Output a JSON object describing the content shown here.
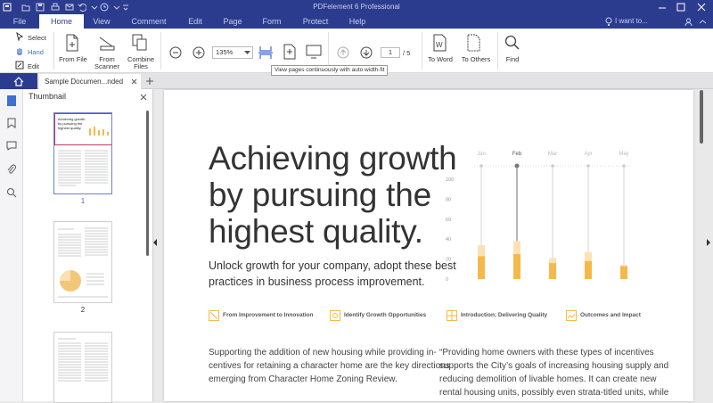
{
  "window": {
    "title": "PDFelement 6 Professional"
  },
  "menu": {
    "items": [
      "File",
      "Home",
      "View",
      "Comment",
      "Edit",
      "Page",
      "Form",
      "Protect",
      "Help"
    ],
    "search_placeholder": "I want to..."
  },
  "ribbon": {
    "select": "Select",
    "hand": "Hand",
    "edit": "Edit",
    "from_file": "From File",
    "from_scanner_1": "From",
    "from_scanner_2": "Scanner",
    "combine_1": "Combine",
    "combine_2": "Files",
    "zoom": "135%",
    "page_current": "1",
    "page_total": "/ 5",
    "to_word": "To Word",
    "to_others": "To Others",
    "find": "Find",
    "tooltip": "View pages continuously with auto width-fit"
  },
  "tabs": {
    "doc": "Sample Documen...nded"
  },
  "thumbnail": {
    "title": "Thumbnail",
    "pages": [
      "1",
      "2"
    ],
    "snippet": [
      "Achieving growth",
      "by pursuing the",
      "highest quality."
    ]
  },
  "document": {
    "title": [
      "Achieving growth",
      "by pursuing the",
      "highest quality."
    ],
    "subtitle": [
      "Unlock growth for your company, adopt these best",
      "practices in business process improvement."
    ],
    "features": [
      "From Improvement to Innovation",
      "Identify Growth Opportunities",
      "Introduction; Delivering Quality",
      "Outcomes and Impact"
    ],
    "col1": [
      "Supporting the addition of new housing while providing in-",
      "centives for retaining a character home are the key directions",
      "emerging from Character Home Zoning Review."
    ],
    "col2": [
      "“Providing home owners with these types of incentives",
      "supports the City’s goals of increasing housing supply and",
      "reducing demolition of livable homes.  It can create new",
      "rental housing units, possibly even strata-titled units, while"
    ]
  },
  "chart_data": {
    "type": "bar",
    "categories": [
      "Jan",
      "Feb",
      "Mar",
      "Apr",
      "May"
    ],
    "highlighted_category": "Feb",
    "ylim": [
      0,
      100
    ],
    "yticks": [
      0,
      20,
      40,
      60,
      80,
      100
    ],
    "series": [
      {
        "values": [
          23,
          25,
          16,
          18,
          13
        ]
      },
      {
        "values": [
          34,
          38,
          21,
          27,
          14
        ]
      }
    ],
    "colors": {
      "lower": "#f5b94a",
      "upper": "#fbe2b5",
      "guide": "#cccccc"
    }
  },
  "colors": {
    "brand": "#2b3c8f",
    "accent": "#3f6fd1"
  }
}
